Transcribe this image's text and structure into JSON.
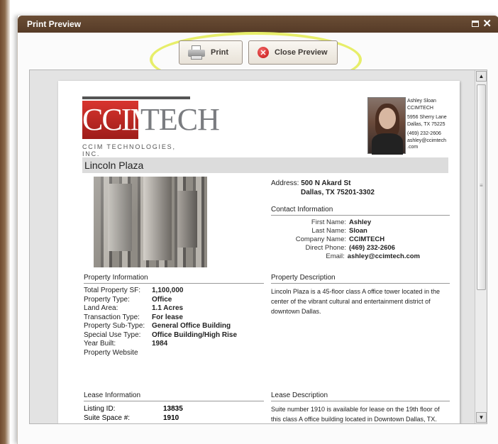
{
  "window": {
    "title": "Print Preview"
  },
  "toolbar": {
    "print_label": "Print",
    "close_label": "Close Preview"
  },
  "header": {
    "logo_left": "CCIM",
    "logo_right": "TECH",
    "logo_sub": "CCIM TECHNOLOGIES, INC.",
    "agent": {
      "name": "Ashley Sloan",
      "company": "CCIMTECH",
      "street": "5956 Sherry Lane",
      "city": "Dallas, TX 75225",
      "phone": "(469) 232-2606",
      "email_1": "ashley@ccimtech",
      "email_2": ".com"
    }
  },
  "property": {
    "title": "Lincoln Plaza",
    "address_label": "Address:",
    "address_line1": "500 N Akard St",
    "address_line2": "Dallas, TX 75201-3302"
  },
  "contact": {
    "heading": "Contact Information",
    "rows": [
      {
        "label": "First Name:",
        "value": "Ashley"
      },
      {
        "label": "Last Name:",
        "value": "Sloan"
      },
      {
        "label": "Company Name:",
        "value": "CCIMTECH"
      },
      {
        "label": "Direct Phone:",
        "value": "(469) 232-2606"
      },
      {
        "label": "Email:",
        "value": "ashley@ccimtech.com"
      }
    ]
  },
  "property_info": {
    "heading": "Property Information",
    "rows": [
      {
        "label": "Total Property SF:",
        "value": "1,100,000"
      },
      {
        "label": "Property Type:",
        "value": "Office"
      },
      {
        "label": "Land Area:",
        "value": "1.1 Acres"
      },
      {
        "label": "Transaction Type:",
        "value": "For lease"
      },
      {
        "label": "Property Sub-Type:",
        "value": "General Office Building"
      },
      {
        "label": "Special Use Type:",
        "value": "Office Building/High Rise"
      },
      {
        "label": "Year Built:",
        "value": "1984"
      },
      {
        "label": "Property Website",
        "value": ""
      }
    ]
  },
  "property_description": {
    "heading": "Property Description",
    "text": "Lincoln Plaza is a 45-floor class A office tower located in the center of the vibrant cultural and entertainment district of downtown Dallas."
  },
  "lease_info": {
    "heading": "Lease Information",
    "rows": [
      {
        "label": "Listing ID:",
        "value": "13835"
      },
      {
        "label": "Suite Space #:",
        "value": "1910"
      }
    ]
  },
  "lease_description": {
    "heading": "Lease Description",
    "text": "Suite number 1910 is available for lease on the 19th floor of this class A office building located in Downtown Dallas, TX."
  }
}
